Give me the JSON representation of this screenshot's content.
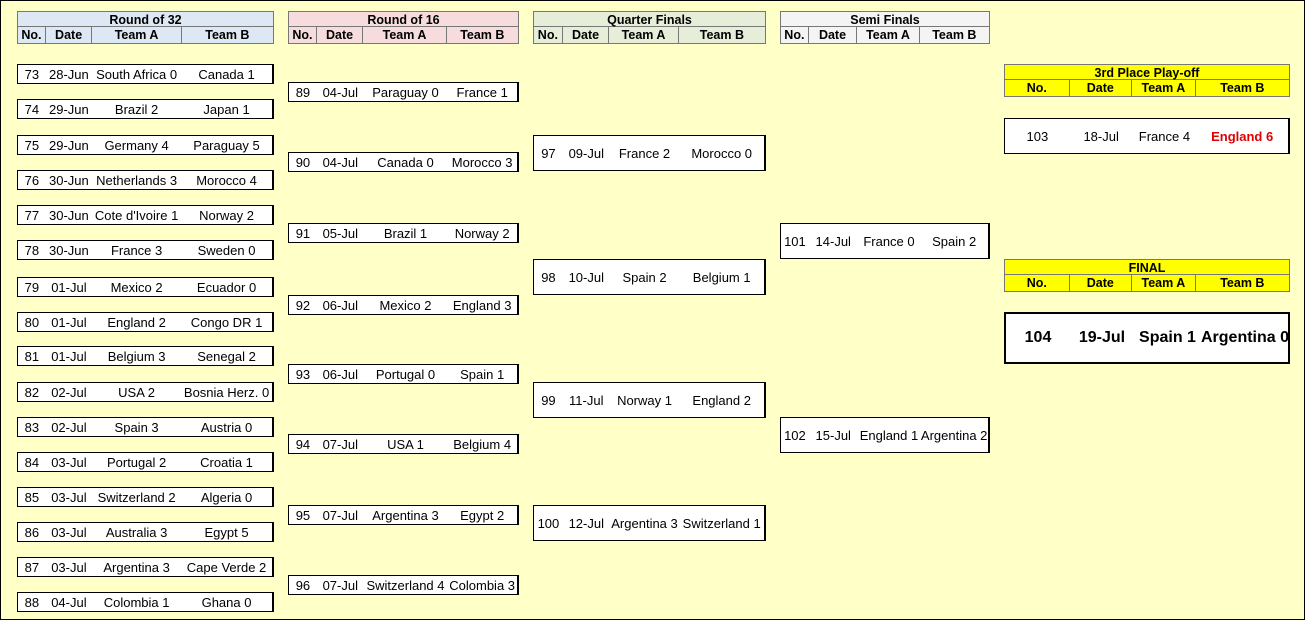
{
  "columns": [
    "No.",
    "Date",
    "Team A",
    "Team B"
  ],
  "rounds": {
    "r32": "Round of 32",
    "r16": "Round of 16",
    "qf": "Quarter Finals",
    "sf": "Semi Finals",
    "third": "3rd Place Play-off",
    "final": "FINAL"
  },
  "r32": [
    {
      "no": "73",
      "date": "28-Jun",
      "a": "South Africa 0",
      "b": "Canada 1"
    },
    {
      "no": "74",
      "date": "29-Jun",
      "a": "Brazil 2",
      "b": "Japan 1"
    },
    {
      "no": "75",
      "date": "29-Jun",
      "a": "Germany 4",
      "b": "Paraguay 5"
    },
    {
      "no": "76",
      "date": "30-Jun",
      "a": "Netherlands 3",
      "b": "Morocco 4"
    },
    {
      "no": "77",
      "date": "30-Jun",
      "a": "Cote d'Ivoire 1",
      "b": "Norway 2"
    },
    {
      "no": "78",
      "date": "30-Jun",
      "a": "France 3",
      "b": "Sweden 0"
    },
    {
      "no": "79",
      "date": "01-Jul",
      "a": "Mexico 2",
      "b": "Ecuador 0"
    },
    {
      "no": "80",
      "date": "01-Jul",
      "a": "England 2",
      "b": "Congo DR 1"
    },
    {
      "no": "81",
      "date": "01-Jul",
      "a": "Belgium 3",
      "b": "Senegal 2"
    },
    {
      "no": "82",
      "date": "02-Jul",
      "a": "USA 2",
      "b": "Bosnia Herz. 0"
    },
    {
      "no": "83",
      "date": "02-Jul",
      "a": "Spain 3",
      "b": "Austria 0"
    },
    {
      "no": "84",
      "date": "03-Jul",
      "a": "Portugal 2",
      "b": "Croatia 1"
    },
    {
      "no": "85",
      "date": "03-Jul",
      "a": "Switzerland 2",
      "b": "Algeria 0"
    },
    {
      "no": "86",
      "date": "03-Jul",
      "a": "Australia 3",
      "b": "Egypt 5"
    },
    {
      "no": "87",
      "date": "03-Jul",
      "a": "Argentina 3",
      "b": "Cape Verde 2"
    },
    {
      "no": "88",
      "date": "04-Jul",
      "a": "Colombia 1",
      "b": "Ghana 0"
    }
  ],
  "r16": [
    {
      "no": "89",
      "date": "04-Jul",
      "a": "Paraguay 0",
      "b": "France 1"
    },
    {
      "no": "90",
      "date": "04-Jul",
      "a": "Canada 0",
      "b": "Morocco 3"
    },
    {
      "no": "91",
      "date": "05-Jul",
      "a": "Brazil 1",
      "b": "Norway 2"
    },
    {
      "no": "92",
      "date": "06-Jul",
      "a": "Mexico 2",
      "b": "England 3"
    },
    {
      "no": "93",
      "date": "06-Jul",
      "a": "Portugal 0",
      "b": "Spain 1"
    },
    {
      "no": "94",
      "date": "07-Jul",
      "a": "USA 1",
      "b": "Belgium 4"
    },
    {
      "no": "95",
      "date": "07-Jul",
      "a": "Argentina 3",
      "b": "Egypt 2"
    },
    {
      "no": "96",
      "date": "07-Jul",
      "a": "Switzerland 4",
      "b": "Colombia 3"
    }
  ],
  "qf": [
    {
      "no": "97",
      "date": "09-Jul",
      "a": "France 2",
      "b": "Morocco 0"
    },
    {
      "no": "98",
      "date": "10-Jul",
      "a": "Spain 2",
      "b": "Belgium 1"
    },
    {
      "no": "99",
      "date": "11-Jul",
      "a": "Norway 1",
      "b": "England 2"
    },
    {
      "no": "100",
      "date": "12-Jul",
      "a": "Argentina 3",
      "b": "Switzerland 1"
    }
  ],
  "sf": [
    {
      "no": "101",
      "date": "14-Jul",
      "a": "France 0",
      "b": "Spain 2"
    },
    {
      "no": "102",
      "date": "15-Jul",
      "a": "England 1",
      "b": "Argentina 2"
    }
  ],
  "third": {
    "no": "103",
    "date": "18-Jul",
    "a": "France 4",
    "b": "England 6"
  },
  "final": {
    "no": "104",
    "date": "19-Jul",
    "a": "Spain 1",
    "b": "Argentina 0"
  },
  "colors": {
    "background": "#ffffc8",
    "final_header": "#ffff00",
    "winner_highlight": "#e00000"
  }
}
